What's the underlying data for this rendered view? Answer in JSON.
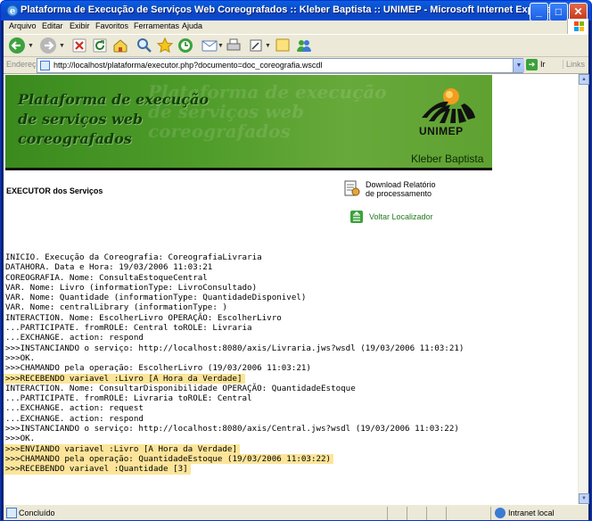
{
  "window": {
    "title": "Plataforma de Execução de Serviços Web Coreografados :: Kleber Baptista :: UNIMEP - Microsoft Internet Explorer",
    "min_glyph": "_",
    "max_glyph": "□",
    "close_glyph": "✕"
  },
  "menu": [
    "Arquivo",
    "Editar",
    "Exibir",
    "Favoritos",
    "Ferramentas",
    "Ajuda"
  ],
  "address": {
    "label": "Endereço",
    "url": "http://localhost/plataforma/executor.php?documento=doc_coreografia.wscdl",
    "go_label": "Ir",
    "links_label": "Links"
  },
  "banner": {
    "title_lines": [
      "Plataforma de execução",
      "de serviços web",
      "coreografados"
    ],
    "logo_text": "UNIMEP",
    "author": "Kleber Baptista"
  },
  "page": {
    "section_title": "EXECUTOR dos Serviços",
    "download_label_line1": "Download Relatório",
    "download_label_line2": "de processamento",
    "back_label": "Voltar Localizador",
    "highlight_color": "#fce59a"
  },
  "log": [
    {
      "text": "INICIO. Execução da Coreografia: CoreografiaLivraria",
      "hl": false
    },
    {
      "text": "DATAHORA. Data e Hora: 19/03/2006 11:03:21",
      "hl": false
    },
    {
      "text": "COREOGRAFIA. Nome: ConsultaEstoqueCentral",
      "hl": false
    },
    {
      "text": "VAR. Nome: Livro (informationType: LivroConsultado)",
      "hl": false
    },
    {
      "text": "VAR. Nome: Quantidade (informationType: QuantidadeDisponivel)",
      "hl": false
    },
    {
      "text": "VAR. Nome: centralLibrary (informationType: )",
      "hl": false
    },
    {
      "text": "INTERACTION. Nome: EscolherLivro OPERAÇÃO: EscolherLivro",
      "hl": false
    },
    {
      "text": "...PARTICIPATE. fromROLE: Central toROLE: Livraria",
      "hl": false
    },
    {
      "text": "...EXCHANGE. action: respond",
      "hl": false
    },
    {
      "text": ">>>INSTANCIANDO o serviço: http://localhost:8080/axis/Livraria.jws?wsdl (19/03/2006 11:03:21)",
      "hl": false
    },
    {
      "text": ">>>OK.",
      "hl": false
    },
    {
      "text": ">>>CHAMANDO pela operação: EscolherLivro (19/03/2006 11:03:21)",
      "hl": false
    },
    {
      "text": ">>>RECEBENDO variavel :Livro [A Hora da Verdade]",
      "hl": true
    },
    {
      "text": "INTERACTION. Nome: ConsultarDisponibilidade OPERAÇÃO: QuantidadeEstoque",
      "hl": false
    },
    {
      "text": "...PARTICIPATE. fromROLE: Livraria toROLE: Central",
      "hl": false
    },
    {
      "text": "...EXCHANGE. action: request",
      "hl": false
    },
    {
      "text": "...EXCHANGE. action: respond",
      "hl": false
    },
    {
      "text": ">>>INSTANCIANDO o serviço: http://localhost:8080/axis/Central.jws?wsdl (19/03/2006 11:03:22)",
      "hl": false
    },
    {
      "text": ">>>OK.",
      "hl": false
    },
    {
      "text": ">>>ENVIANDO variavel :Livro [A Hora da Verdade]",
      "hl": true
    },
    {
      "text": ">>>CHAMANDO pela operação: QuantidadeEstoque (19/03/2006 11:03:22)",
      "hl": true
    },
    {
      "text": ">>>RECEBENDO variavel :Quantidade [3]",
      "hl": true
    }
  ],
  "status": {
    "text": "Concluído",
    "zone": "Intranet local"
  }
}
